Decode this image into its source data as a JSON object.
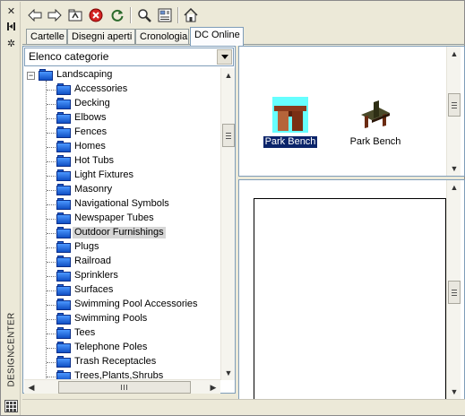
{
  "panel": {
    "vertical_title": "DESIGNCENTER",
    "controls": [
      {
        "name": "close-icon",
        "glyph": "✕"
      },
      {
        "name": "autohide-icon",
        "glyph": "⟼"
      },
      {
        "name": "properties-icon",
        "glyph": "✲"
      }
    ]
  },
  "toolbar": {
    "buttons": [
      "back-icon",
      "forward-icon",
      "up-icon",
      "stop-icon",
      "reload-icon",
      "search-icon",
      "favorites-icon",
      "home-icon"
    ]
  },
  "tabs": [
    {
      "label": "Cartelle",
      "active": false
    },
    {
      "label": "Disegni aperti",
      "active": false
    },
    {
      "label": "Cronologia",
      "active": false
    },
    {
      "label": "DC Online",
      "active": true
    }
  ],
  "categories": {
    "combo_value": "Elenco categorie",
    "root": "Landscaping",
    "items": [
      "Accessories",
      "Decking",
      "Elbows",
      "Fences",
      "Homes",
      "Hot Tubs",
      "Light Fixtures",
      "Masonry",
      "Navigational Symbols",
      "Newspaper Tubes",
      "Outdoor Furnishings",
      "Plugs",
      "Railroad",
      "Sprinklers",
      "Surfaces",
      "Swimming Pool Accessories",
      "Swimming Pools",
      "Tees",
      "Telephone Poles",
      "Trash Receptacles",
      "Trees,Plants,Shrubs"
    ],
    "selected": "Outdoor Furnishings"
  },
  "content": {
    "items": [
      {
        "label": "Park Bench",
        "selected": true,
        "style": "front"
      },
      {
        "label": "Park Bench",
        "selected": false,
        "style": "iso"
      }
    ]
  },
  "colors": {
    "selection": "#0a246a",
    "folder": "#1d64d8",
    "thumb_bg": "#66ffff",
    "bench": "#a0522d"
  }
}
